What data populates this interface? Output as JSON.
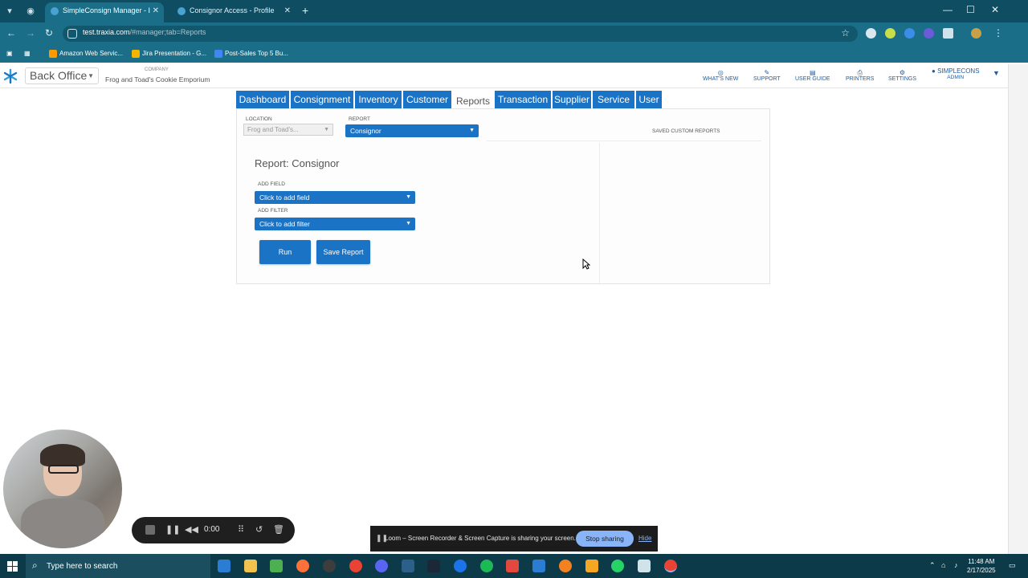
{
  "browser": {
    "tabs": [
      {
        "title": "SimpleConsign Manager - I",
        "active": true
      },
      {
        "title": "Consignor Access - Profile",
        "active": false
      }
    ],
    "url_host": "test.traxia.com",
    "url_path": "/#manager;tab=Reports",
    "bookmarks": [
      {
        "label": "Amazon Web Servic...",
        "color": "#ff9900"
      },
      {
        "label": "Jira Presentation - G...",
        "color": "#f4b400"
      },
      {
        "label": "Post-Sales Top 5 Bu...",
        "color": "#4285f4"
      }
    ]
  },
  "app": {
    "module_label": "Back Office",
    "company_label": "COMPANY",
    "company_name": "Frog and Toad's Cookie Emporium",
    "header_links": [
      {
        "label": "WHAT'S NEW",
        "icon": "compass-icon"
      },
      {
        "label": "SUPPORT",
        "icon": "support-icon"
      },
      {
        "label": "USER GUIDE",
        "icon": "book-icon"
      },
      {
        "label": "PRINTERS",
        "icon": "printer-icon"
      },
      {
        "label": "SETTINGS",
        "icon": "gear-icon"
      }
    ],
    "user": {
      "name": "SIMPLECONS",
      "role": "ADMIN"
    },
    "nav_tabs": [
      {
        "label": "Dashboard",
        "current": false
      },
      {
        "label": "Consignment",
        "current": false
      },
      {
        "label": "Inventory",
        "current": false
      },
      {
        "label": "Customer",
        "current": false
      },
      {
        "label": "Reports",
        "current": true
      },
      {
        "label": "Transaction",
        "current": false
      },
      {
        "label": "Supplier",
        "current": false
      },
      {
        "label": "Service",
        "current": false
      },
      {
        "label": "User",
        "current": false
      }
    ]
  },
  "report": {
    "location_label": "LOCATION",
    "location_value": "Frog and Toad's...",
    "report_label": "REPORT",
    "report_value": "Consignor",
    "saved_label": "SAVED CUSTOM REPORTS",
    "title": "Report: Consignor",
    "add_field_label": "ADD FIELD",
    "add_field_value": "Click to add field",
    "add_filter_label": "ADD FILTER",
    "add_filter_value": "Click to add filter",
    "run_label": "Run",
    "save_label": "Save Report"
  },
  "loom": {
    "time": "0:00",
    "share_message": "Loom – Screen Recorder & Screen Capture is sharing your screen.",
    "stop_label": "Stop sharing",
    "hide_label": "Hide"
  },
  "taskbar": {
    "search_placeholder": "Type here to search",
    "time": "11:48 AM",
    "date": "2/17/2025"
  },
  "colors": {
    "chrome_dark": "#0f4d62",
    "chrome": "#1b6e88",
    "app_blue": "#1a73c4",
    "taskbar": "#0d3a48"
  }
}
